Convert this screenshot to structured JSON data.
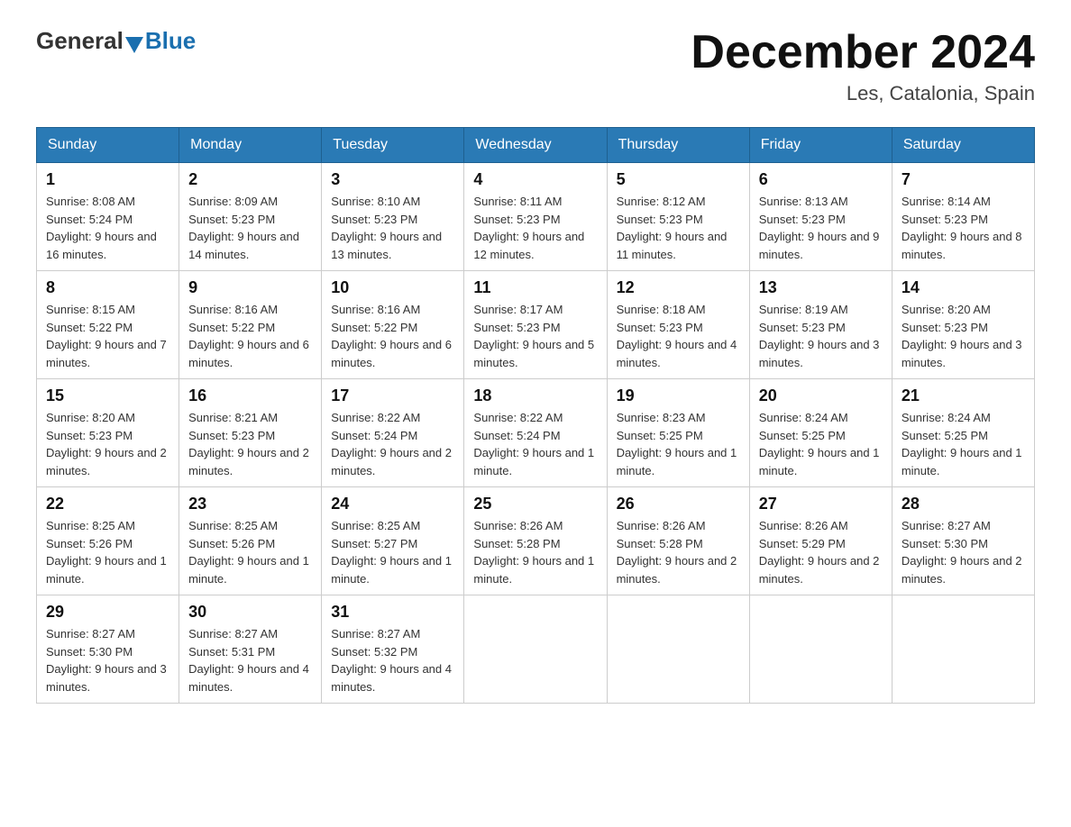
{
  "header": {
    "logo_general": "General",
    "logo_blue": "Blue",
    "title": "December 2024",
    "subtitle": "Les, Catalonia, Spain"
  },
  "weekdays": [
    "Sunday",
    "Monday",
    "Tuesday",
    "Wednesday",
    "Thursday",
    "Friday",
    "Saturday"
  ],
  "weeks": [
    [
      {
        "day": "1",
        "sunrise": "8:08 AM",
        "sunset": "5:24 PM",
        "daylight": "9 hours and 16 minutes."
      },
      {
        "day": "2",
        "sunrise": "8:09 AM",
        "sunset": "5:23 PM",
        "daylight": "9 hours and 14 minutes."
      },
      {
        "day": "3",
        "sunrise": "8:10 AM",
        "sunset": "5:23 PM",
        "daylight": "9 hours and 13 minutes."
      },
      {
        "day": "4",
        "sunrise": "8:11 AM",
        "sunset": "5:23 PM",
        "daylight": "9 hours and 12 minutes."
      },
      {
        "day": "5",
        "sunrise": "8:12 AM",
        "sunset": "5:23 PM",
        "daylight": "9 hours and 11 minutes."
      },
      {
        "day": "6",
        "sunrise": "8:13 AM",
        "sunset": "5:23 PM",
        "daylight": "9 hours and 9 minutes."
      },
      {
        "day": "7",
        "sunrise": "8:14 AM",
        "sunset": "5:23 PM",
        "daylight": "9 hours and 8 minutes."
      }
    ],
    [
      {
        "day": "8",
        "sunrise": "8:15 AM",
        "sunset": "5:22 PM",
        "daylight": "9 hours and 7 minutes."
      },
      {
        "day": "9",
        "sunrise": "8:16 AM",
        "sunset": "5:22 PM",
        "daylight": "9 hours and 6 minutes."
      },
      {
        "day": "10",
        "sunrise": "8:16 AM",
        "sunset": "5:22 PM",
        "daylight": "9 hours and 6 minutes."
      },
      {
        "day": "11",
        "sunrise": "8:17 AM",
        "sunset": "5:23 PM",
        "daylight": "9 hours and 5 minutes."
      },
      {
        "day": "12",
        "sunrise": "8:18 AM",
        "sunset": "5:23 PM",
        "daylight": "9 hours and 4 minutes."
      },
      {
        "day": "13",
        "sunrise": "8:19 AM",
        "sunset": "5:23 PM",
        "daylight": "9 hours and 3 minutes."
      },
      {
        "day": "14",
        "sunrise": "8:20 AM",
        "sunset": "5:23 PM",
        "daylight": "9 hours and 3 minutes."
      }
    ],
    [
      {
        "day": "15",
        "sunrise": "8:20 AM",
        "sunset": "5:23 PM",
        "daylight": "9 hours and 2 minutes."
      },
      {
        "day": "16",
        "sunrise": "8:21 AM",
        "sunset": "5:23 PM",
        "daylight": "9 hours and 2 minutes."
      },
      {
        "day": "17",
        "sunrise": "8:22 AM",
        "sunset": "5:24 PM",
        "daylight": "9 hours and 2 minutes."
      },
      {
        "day": "18",
        "sunrise": "8:22 AM",
        "sunset": "5:24 PM",
        "daylight": "9 hours and 1 minute."
      },
      {
        "day": "19",
        "sunrise": "8:23 AM",
        "sunset": "5:25 PM",
        "daylight": "9 hours and 1 minute."
      },
      {
        "day": "20",
        "sunrise": "8:24 AM",
        "sunset": "5:25 PM",
        "daylight": "9 hours and 1 minute."
      },
      {
        "day": "21",
        "sunrise": "8:24 AM",
        "sunset": "5:25 PM",
        "daylight": "9 hours and 1 minute."
      }
    ],
    [
      {
        "day": "22",
        "sunrise": "8:25 AM",
        "sunset": "5:26 PM",
        "daylight": "9 hours and 1 minute."
      },
      {
        "day": "23",
        "sunrise": "8:25 AM",
        "sunset": "5:26 PM",
        "daylight": "9 hours and 1 minute."
      },
      {
        "day": "24",
        "sunrise": "8:25 AM",
        "sunset": "5:27 PM",
        "daylight": "9 hours and 1 minute."
      },
      {
        "day": "25",
        "sunrise": "8:26 AM",
        "sunset": "5:28 PM",
        "daylight": "9 hours and 1 minute."
      },
      {
        "day": "26",
        "sunrise": "8:26 AM",
        "sunset": "5:28 PM",
        "daylight": "9 hours and 2 minutes."
      },
      {
        "day": "27",
        "sunrise": "8:26 AM",
        "sunset": "5:29 PM",
        "daylight": "9 hours and 2 minutes."
      },
      {
        "day": "28",
        "sunrise": "8:27 AM",
        "sunset": "5:30 PM",
        "daylight": "9 hours and 2 minutes."
      }
    ],
    [
      {
        "day": "29",
        "sunrise": "8:27 AM",
        "sunset": "5:30 PM",
        "daylight": "9 hours and 3 minutes."
      },
      {
        "day": "30",
        "sunrise": "8:27 AM",
        "sunset": "5:31 PM",
        "daylight": "9 hours and 4 minutes."
      },
      {
        "day": "31",
        "sunrise": "8:27 AM",
        "sunset": "5:32 PM",
        "daylight": "9 hours and 4 minutes."
      },
      null,
      null,
      null,
      null
    ]
  ]
}
